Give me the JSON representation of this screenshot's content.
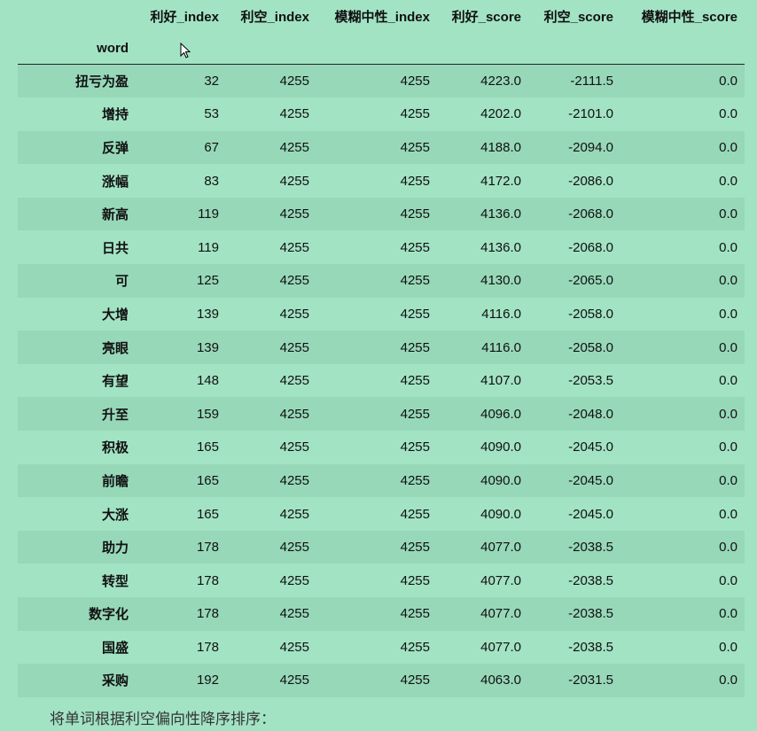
{
  "table": {
    "columns": [
      "利好_index",
      "利空_index",
      "模糊中性_index",
      "利好_score",
      "利空_score",
      "模糊中性_score"
    ],
    "index_name": "word",
    "rows": [
      {
        "word": "扭亏为盈",
        "values": [
          "32",
          "4255",
          "4255",
          "4223.0",
          "-2111.5",
          "0.0"
        ]
      },
      {
        "word": "增持",
        "values": [
          "53",
          "4255",
          "4255",
          "4202.0",
          "-2101.0",
          "0.0"
        ]
      },
      {
        "word": "反弹",
        "values": [
          "67",
          "4255",
          "4255",
          "4188.0",
          "-2094.0",
          "0.0"
        ]
      },
      {
        "word": "涨幅",
        "values": [
          "83",
          "4255",
          "4255",
          "4172.0",
          "-2086.0",
          "0.0"
        ]
      },
      {
        "word": "新高",
        "values": [
          "119",
          "4255",
          "4255",
          "4136.0",
          "-2068.0",
          "0.0"
        ]
      },
      {
        "word": "日共",
        "values": [
          "119",
          "4255",
          "4255",
          "4136.0",
          "-2068.0",
          "0.0"
        ]
      },
      {
        "word": "可",
        "values": [
          "125",
          "4255",
          "4255",
          "4130.0",
          "-2065.0",
          "0.0"
        ]
      },
      {
        "word": "大增",
        "values": [
          "139",
          "4255",
          "4255",
          "4116.0",
          "-2058.0",
          "0.0"
        ]
      },
      {
        "word": "亮眼",
        "values": [
          "139",
          "4255",
          "4255",
          "4116.0",
          "-2058.0",
          "0.0"
        ]
      },
      {
        "word": "有望",
        "values": [
          "148",
          "4255",
          "4255",
          "4107.0",
          "-2053.5",
          "0.0"
        ]
      },
      {
        "word": "升至",
        "values": [
          "159",
          "4255",
          "4255",
          "4096.0",
          "-2048.0",
          "0.0"
        ]
      },
      {
        "word": "积极",
        "values": [
          "165",
          "4255",
          "4255",
          "4090.0",
          "-2045.0",
          "0.0"
        ]
      },
      {
        "word": "前瞻",
        "values": [
          "165",
          "4255",
          "4255",
          "4090.0",
          "-2045.0",
          "0.0"
        ]
      },
      {
        "word": "大涨",
        "values": [
          "165",
          "4255",
          "4255",
          "4090.0",
          "-2045.0",
          "0.0"
        ]
      },
      {
        "word": "助力",
        "values": [
          "178",
          "4255",
          "4255",
          "4077.0",
          "-2038.5",
          "0.0"
        ]
      },
      {
        "word": "转型",
        "values": [
          "178",
          "4255",
          "4255",
          "4077.0",
          "-2038.5",
          "0.0"
        ]
      },
      {
        "word": "数字化",
        "values": [
          "178",
          "4255",
          "4255",
          "4077.0",
          "-2038.5",
          "0.0"
        ]
      },
      {
        "word": "国盛",
        "values": [
          "178",
          "4255",
          "4255",
          "4077.0",
          "-2038.5",
          "0.0"
        ]
      },
      {
        "word": "采购",
        "values": [
          "192",
          "4255",
          "4255",
          "4063.0",
          "-2031.5",
          "0.0"
        ]
      }
    ]
  },
  "footer_text": "将单词根据利空偏向性降序排序：",
  "cursor_icon": "mouse-pointer-icon",
  "colors": {
    "background": "#a2e3c4",
    "stripe": "#97d8b9"
  }
}
